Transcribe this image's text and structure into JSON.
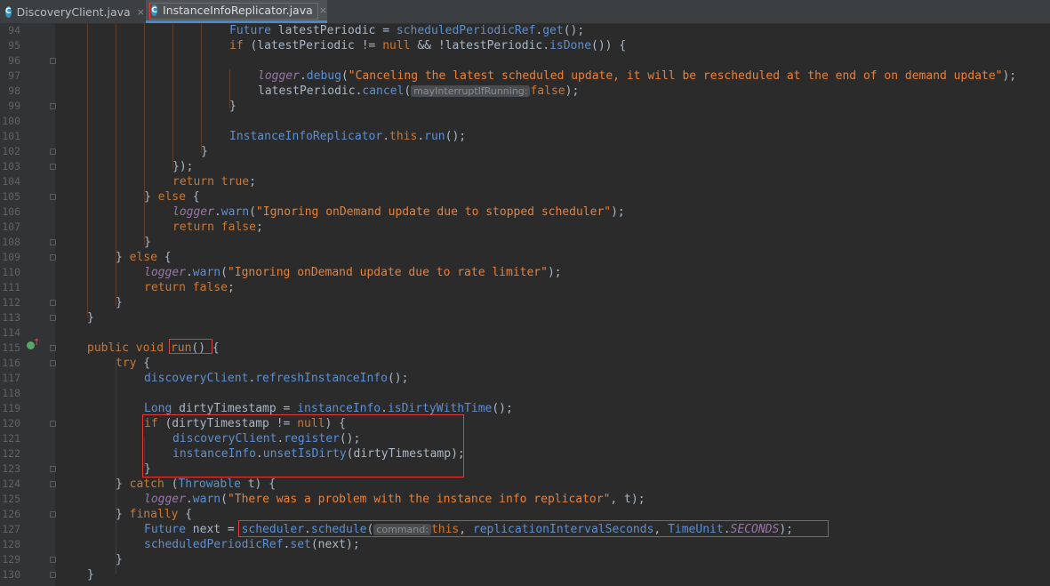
{
  "tabs": [
    {
      "label": "DiscoveryClient.java",
      "icon": "C",
      "close": "×",
      "active": false
    },
    {
      "label": "InstanceInfoReplicator.java",
      "icon": "C",
      "close": "×",
      "active": true
    }
  ],
  "colors": {
    "background": "#2b2b2b",
    "keyword": "#cc7832",
    "string": "#e8813a",
    "method": "#5d8fd1",
    "field": "#9876aa",
    "highlight_box": "#e23b3b"
  },
  "line_numbers": [
    "94",
    "95",
    "96",
    "97",
    "98",
    "99",
    "100",
    "101",
    "102",
    "103",
    "104",
    "105",
    "106",
    "107",
    "108",
    "109",
    "110",
    "111",
    "112",
    "113",
    "114",
    "115",
    "116",
    "117",
    "118",
    "119",
    "120",
    "121",
    "122",
    "123",
    "124",
    "125",
    "126",
    "127",
    "128",
    "129",
    "130"
  ],
  "code": {
    "l94": {
      "a": "Future",
      "b": " latestPeriodic = ",
      "c": "scheduledPeriodicRef",
      "d": ".",
      "e": "get",
      "f": "();"
    },
    "l95": {
      "a": "if",
      "b": " (latestPeriodic != ",
      "c": "null",
      "d": " && !latestPeriodic.",
      "e": "isDone",
      "f": "()) {"
    },
    "l97": {
      "a": "logger",
      "b": ".",
      "c": "debug",
      "d": "(",
      "e": "\"Canceling the latest scheduled update, it will be rescheduled at the end of on demand update\"",
      "f": ");"
    },
    "l98": {
      "a": "latestPeriodic.",
      "b": "cancel",
      "c": "(",
      "hint": "mayInterruptIfRunning:",
      "d": "false",
      "e": ");"
    },
    "l99": {
      "a": "}"
    },
    "l101": {
      "a": "InstanceInfoReplicator",
      "b": ".",
      "c": "this",
      "d": ".",
      "e": "run",
      "f": "();"
    },
    "l102": {
      "a": "}"
    },
    "l103": {
      "a": "});"
    },
    "l104": {
      "a": "return",
      "b": " ",
      "c": "true",
      "d": ";"
    },
    "l105": {
      "a": "} ",
      "b": "else",
      "c": " {"
    },
    "l106": {
      "a": "logger",
      "b": ".",
      "c": "warn",
      "d": "(",
      "e": "\"Ignoring onDemand update due to stopped scheduler\"",
      "f": ");"
    },
    "l107": {
      "a": "return",
      "b": " ",
      "c": "false",
      "d": ";"
    },
    "l108": {
      "a": "}"
    },
    "l109": {
      "a": "} ",
      "b": "else",
      "c": " {"
    },
    "l110": {
      "a": "logger",
      "b": ".",
      "c": "warn",
      "d": "(",
      "e": "\"Ignoring onDemand update due to rate limiter\"",
      "f": ");"
    },
    "l111": {
      "a": "return",
      "b": " ",
      "c": "false",
      "d": ";"
    },
    "l112": {
      "a": "}"
    },
    "l113": {
      "a": "}"
    },
    "l115": {
      "a": "public",
      "b": " ",
      "c": "void",
      "d": " ",
      "e": "run",
      "f": "() {"
    },
    "l116": {
      "a": "try",
      "b": " {"
    },
    "l117": {
      "a": "discoveryClient",
      "b": ".",
      "c": "refreshInstanceInfo",
      "d": "();"
    },
    "l119": {
      "a": "Long",
      "b": " dirtyTimestamp = ",
      "c": "instanceInfo",
      "d": ".",
      "e": "isDirtyWithTime",
      "f": "();"
    },
    "l120": {
      "a": "if",
      "b": " (dirtyTimestamp != ",
      "c": "null",
      "d": ") {"
    },
    "l121": {
      "a": "discoveryClient",
      "b": ".",
      "c": "register",
      "d": "();"
    },
    "l122": {
      "a": "instanceInfo",
      "b": ".",
      "c": "unsetIsDirty",
      "d": "(dirtyTimestamp);"
    },
    "l123": {
      "a": "}"
    },
    "l124": {
      "a": "} ",
      "b": "catch",
      "c": " (",
      "d": "Throwable",
      "e": " t) {"
    },
    "l125": {
      "a": "logger",
      "b": ".",
      "c": "warn",
      "d": "(",
      "e": "\"There was a problem with the instance info replicator\"",
      "f": ", t);"
    },
    "l126": {
      "a": "} ",
      "b": "finally",
      "c": " {"
    },
    "l127": {
      "a": "Future",
      "b": " next = ",
      "c": "scheduler",
      "d": ".",
      "e": "schedule",
      "f": "(",
      "hint": "command:",
      "g": "this",
      "h": ", ",
      "i": "replicationIntervalSeconds",
      "j": ", ",
      "k": "TimeUnit",
      "l": ".",
      "m": "SECONDS",
      "n": ");"
    },
    "l128": {
      "a": "scheduledPeriodicRef",
      "b": ".",
      "c": "set",
      "d": "(next);"
    },
    "l129": {
      "a": "}"
    },
    "l130": {
      "a": "}"
    }
  }
}
